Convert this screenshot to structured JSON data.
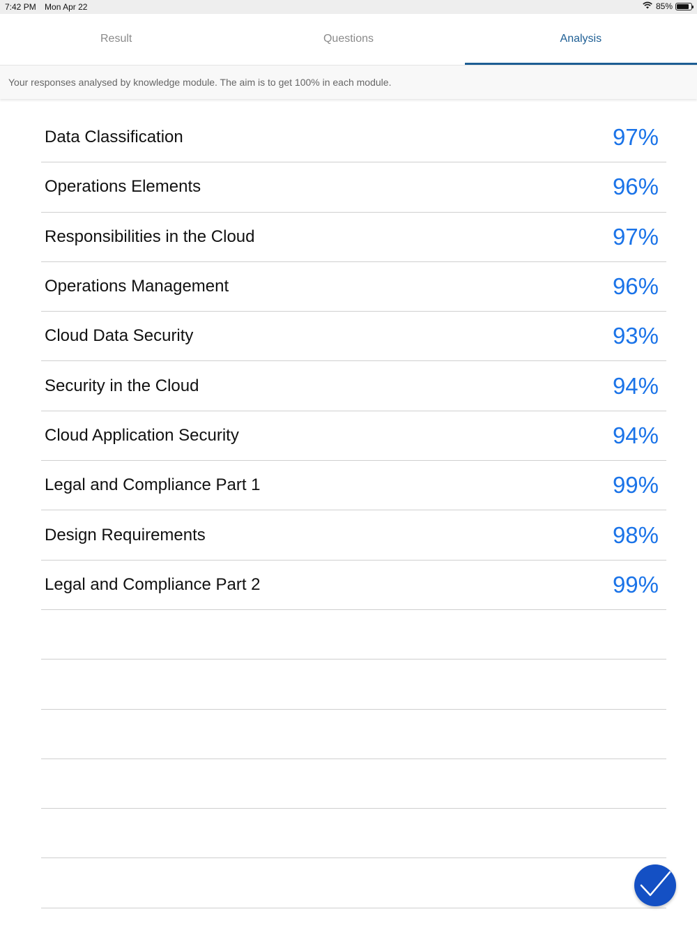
{
  "status_bar": {
    "time": "7:42 PM",
    "date": "Mon Apr 22",
    "battery": "85%",
    "battery_level": 0.85
  },
  "tabs": [
    {
      "label": "Result",
      "active": false
    },
    {
      "label": "Questions",
      "active": false
    },
    {
      "label": "Analysis",
      "active": true
    }
  ],
  "subtitle": "Your responses analysed by knowledge module. The aim is to get 100% in each module.",
  "modules": [
    {
      "name": "Data Classification",
      "score": "97%"
    },
    {
      "name": "Operations Elements",
      "score": "96%"
    },
    {
      "name": "Responsibilities in the Cloud",
      "score": "97%"
    },
    {
      "name": "Operations Management",
      "score": "96%"
    },
    {
      "name": "Cloud Data Security",
      "score": "93%"
    },
    {
      "name": "Security in the Cloud",
      "score": "94%"
    },
    {
      "name": "Cloud Application Security",
      "score": "94%"
    },
    {
      "name": "Legal and Compliance Part 1",
      "score": "99%"
    },
    {
      "name": "Design Requirements",
      "score": "98%"
    },
    {
      "name": "Legal and Compliance Part 2",
      "score": "99%"
    }
  ],
  "empty_rows": 6,
  "colors": {
    "accent": "#1d5e94",
    "score": "#1a73e8",
    "done_button": "#1450c4"
  },
  "done_button_icon": "checkmark-icon"
}
